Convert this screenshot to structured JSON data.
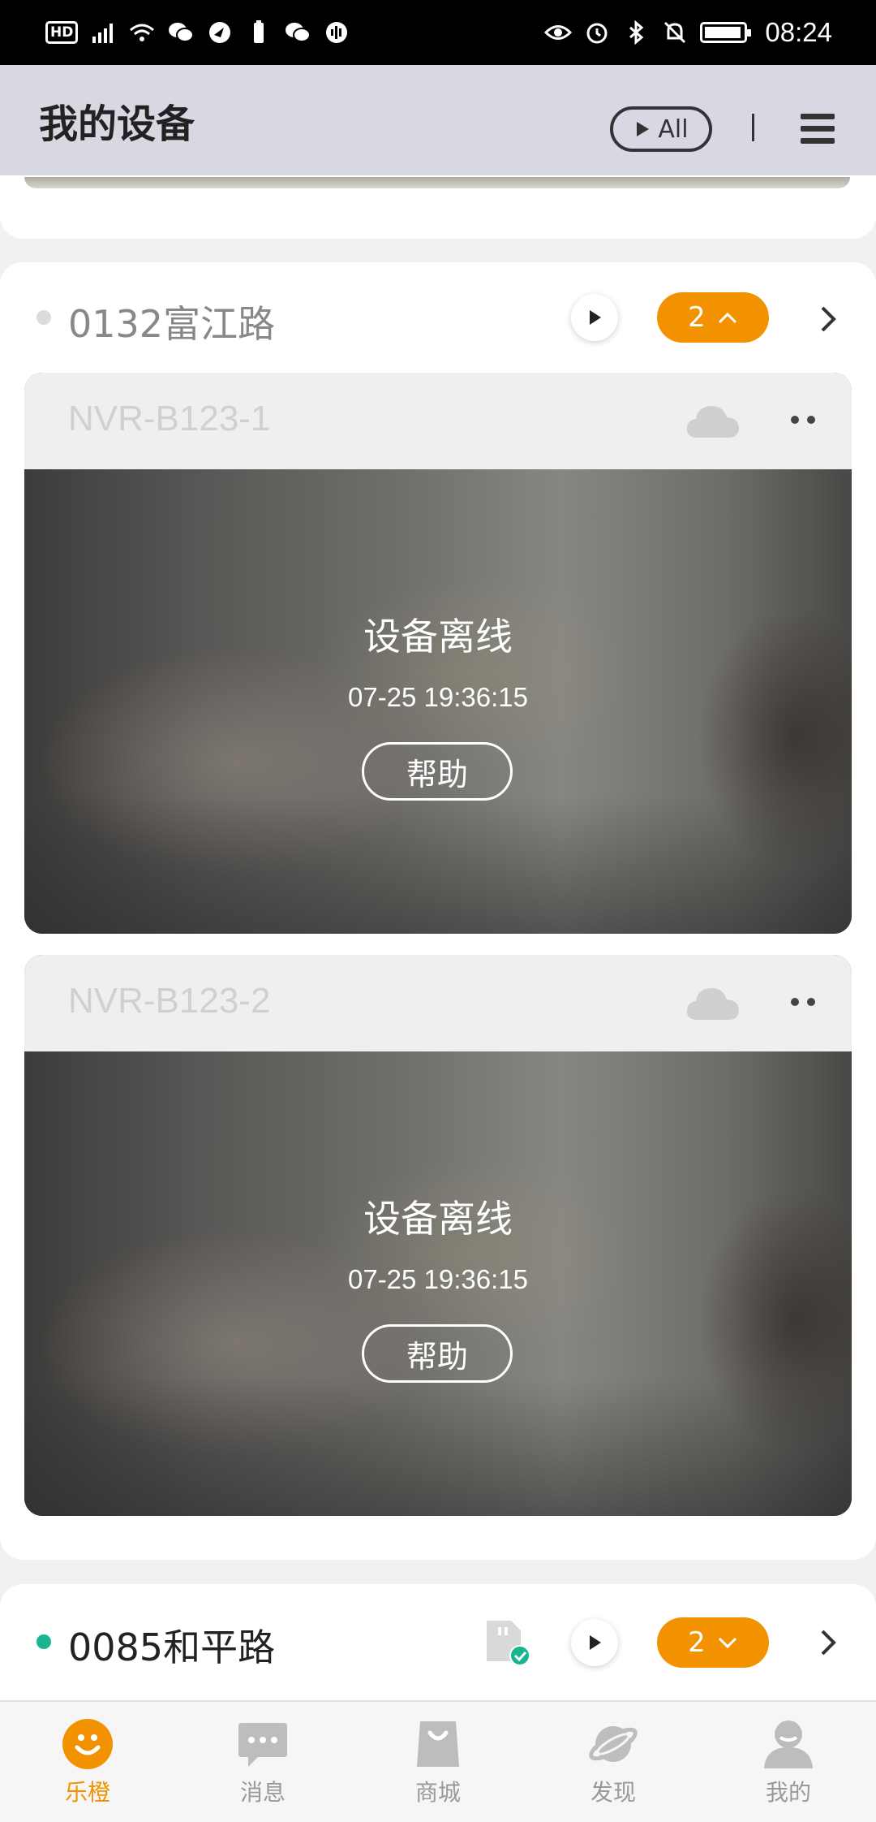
{
  "status_bar": {
    "left_icons": [
      "hd-icon",
      "signal-4g-icon",
      "wifi-icon",
      "wechat-icon",
      "app-icon",
      "battery-saver-icon",
      "wechat-icon",
      "voice-icon"
    ],
    "hd_label": "HD",
    "right_icons": [
      "eye-icon",
      "alarm-icon",
      "bluetooth-icon",
      "mute-bell-icon",
      "battery-icon"
    ],
    "time": "08:24"
  },
  "header": {
    "title": "我的设备",
    "all_label": "All"
  },
  "groups": [
    {
      "name": "0132富江路",
      "online": false,
      "dot_color": "#dcdcdc",
      "name_color": "#888888",
      "count": "2",
      "expanded": true,
      "devices": [
        {
          "name": "NVR-B123-1",
          "status": "设备离线",
          "time": "07-25 19:36:15",
          "help": "帮助"
        },
        {
          "name": "NVR-B123-2",
          "status": "设备离线",
          "time": "07-25 19:36:15",
          "help": "帮助"
        }
      ]
    },
    {
      "name": "0085和平路",
      "online": true,
      "dot_color": "#1ab394",
      "name_color": "#222222",
      "count": "2",
      "expanded": false
    }
  ],
  "tabs": [
    {
      "label": "乐橙",
      "icon": "lechange-smile-icon",
      "active": true
    },
    {
      "label": "消息",
      "icon": "message-icon",
      "active": false
    },
    {
      "label": "商城",
      "icon": "shopping-bag-icon",
      "active": false
    },
    {
      "label": "发现",
      "icon": "planet-icon",
      "active": false
    },
    {
      "label": "我的",
      "icon": "profile-icon",
      "active": false
    }
  ],
  "colors": {
    "accent": "#f39200",
    "online": "#1ab394",
    "header_bg": "#d8d8e3"
  }
}
